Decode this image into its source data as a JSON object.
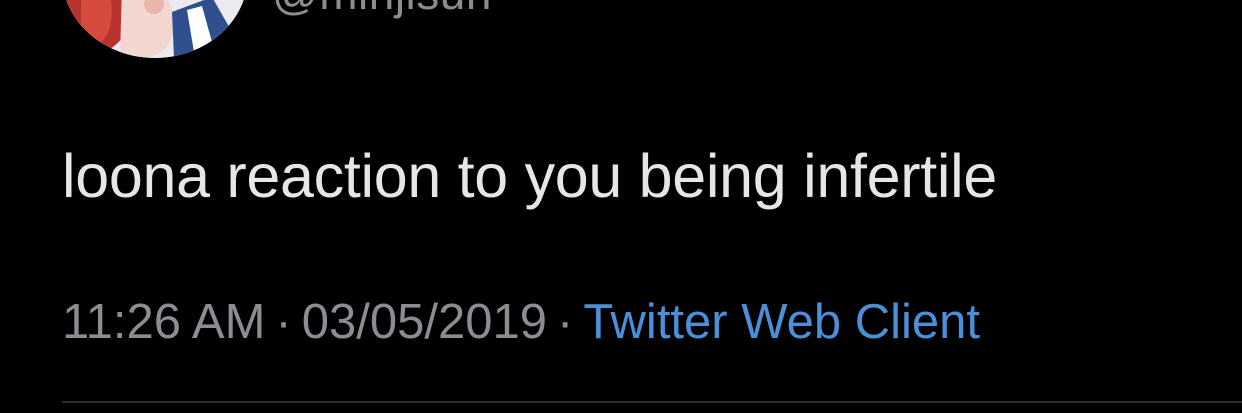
{
  "user": {
    "handle": "@minjisun"
  },
  "tweet": {
    "text": "loona reaction to you being infertile",
    "time": "11:26 AM",
    "separator": "·",
    "date": "03/05/2019",
    "source": "Twitter Web Client"
  },
  "colors": {
    "background": "#000000",
    "text": "#e6e6e6",
    "meta": "#8a8d91",
    "link": "#4a90d9"
  }
}
